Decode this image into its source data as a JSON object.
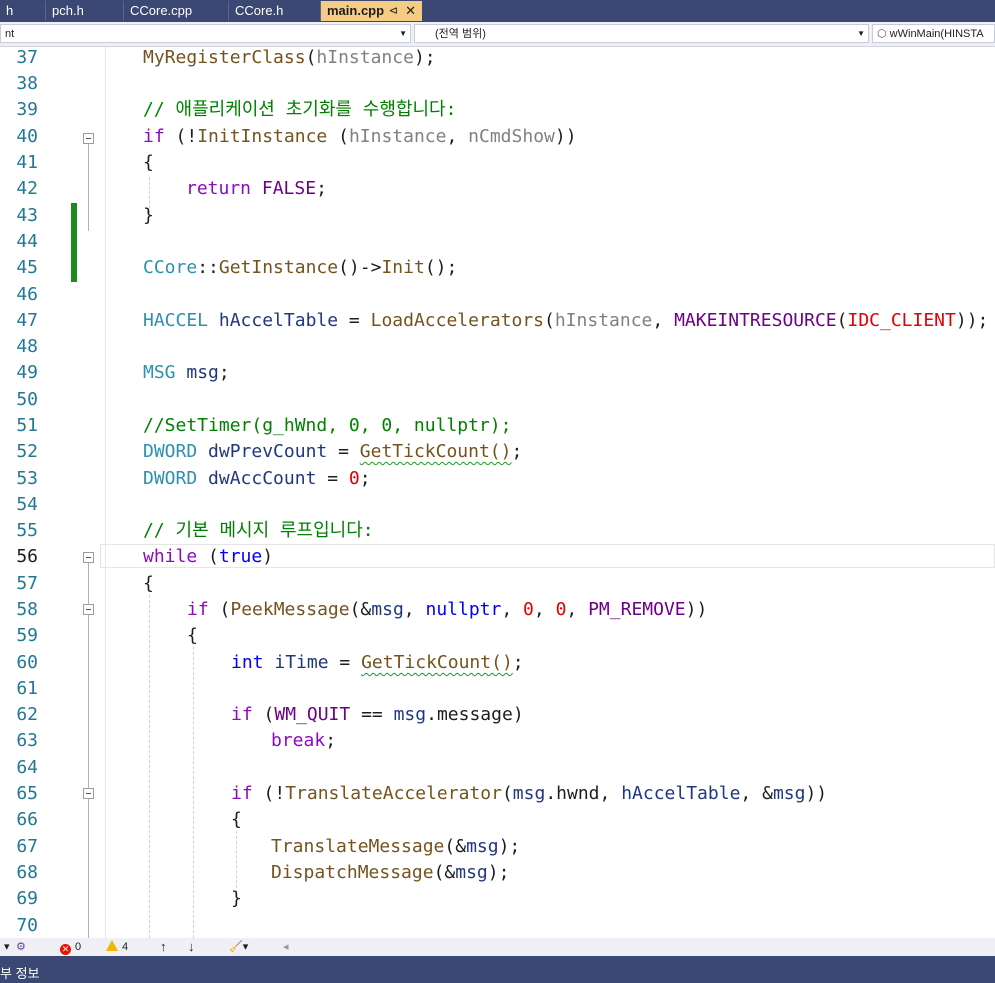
{
  "tabs": [
    {
      "label": "h"
    },
    {
      "label": "pch.h"
    },
    {
      "label": "CCore.cpp"
    },
    {
      "label": "CCore.h"
    },
    {
      "label": "main.cpp",
      "active": true
    }
  ],
  "tab_pin_glyph": "⊲",
  "tab_close_glyph": "✕",
  "navbar": {
    "project_combo": "nt",
    "scope_combo": "(전역 범위)",
    "member_combo": "wWinMain(HINSTA"
  },
  "line_numbers": [
    "37",
    "38",
    "39",
    "40",
    "41",
    "42",
    "43",
    "44",
    "45",
    "46",
    "47",
    "48",
    "49",
    "50",
    "51",
    "52",
    "53",
    "54",
    "55",
    "56",
    "57",
    "58",
    "59",
    "60",
    "61",
    "62",
    "63",
    "64",
    "65",
    "66",
    "67",
    "68",
    "69",
    "70"
  ],
  "current_line": "56",
  "code": {
    "l37": {
      "fn": "MyRegisterClass",
      "p1": "(",
      "pa": "hInstance",
      "p2": ");"
    },
    "l39": {
      "cm": "// 애플리케이션 초기화를 수행합니다:"
    },
    "l40": {
      "kw": "if",
      "t1": " (!",
      "fn": "InitInstance",
      "t2": " (",
      "pa1": "hInstance",
      "t3": ", ",
      "pa2": "nCmdShow",
      "t4": "))"
    },
    "l41": {
      "t": "{"
    },
    "l42": {
      "kw": "return",
      "sp": " ",
      "mc": "FALSE",
      "t": ";"
    },
    "l43": {
      "t": "}"
    },
    "l45": {
      "ty": "CCore",
      "t1": "::",
      "fn1": "GetInstance",
      "t2": "()->",
      "fn2": "Init",
      "t3": "();"
    },
    "l47": {
      "ty": "HACCEL",
      "t1": " ",
      "va": "hAccelTable",
      "t2": " = ",
      "fn": "LoadAccelerators",
      "t3": "(",
      "pa": "hInstance",
      "t4": ", ",
      "mc": "MAKEINTRESOURCE",
      "t5": "(",
      "nu": "IDC_CLIENT",
      "t6": "));"
    },
    "l49": {
      "ty": "MSG",
      "t1": " ",
      "va": "msg",
      "t2": ";"
    },
    "l51": {
      "cm": "//SetTimer(g_hWnd, 0, 0, nullptr);"
    },
    "l52": {
      "ty": "DWORD",
      "t1": " ",
      "va": "dwPrevCount",
      "t2": " = ",
      "fn": "GetTickCount()",
      "t3": ";"
    },
    "l53": {
      "ty": "DWORD",
      "t1": " ",
      "va": "dwAccCount",
      "t2": " = ",
      "nu": "0",
      "t3": ";"
    },
    "l55": {
      "cm": "// 기본 메시지 루프입니다:"
    },
    "l56": {
      "kw": "while",
      "t1": " (",
      "kb": "true",
      "t2": ")"
    },
    "l57": {
      "t": "{"
    },
    "l58": {
      "kw": "if",
      "t1": " (",
      "fn": "PeekMessage",
      "t2": "(&",
      "va": "msg",
      "t3": ", ",
      "kb": "nullptr",
      "t4": ", ",
      "nu1": "0",
      "t5": ", ",
      "nu2": "0",
      "t6": ", ",
      "mc": "PM_REMOVE",
      "t7": "))"
    },
    "l59": {
      "t": "{"
    },
    "l60": {
      "kb": "int",
      "t1": " ",
      "va": "iTime",
      "t2": " = ",
      "fn": "GetTickCount()",
      "t3": ";"
    },
    "l62": {
      "kw": "if",
      "t1": " (",
      "mc": "WM_QUIT",
      "t2": " == ",
      "va": "msg",
      "t3": ".",
      "mem": "message",
      "t4": ")"
    },
    "l63": {
      "kw": "break",
      "t": ";"
    },
    "l65": {
      "kw": "if",
      "t1": " (!",
      "fn": "TranslateAccelerator",
      "t2": "(",
      "va1": "msg",
      "t3": ".",
      "mem": "hwnd",
      "t4": ", ",
      "va2": "hAccelTable",
      "t5": ", &",
      "va3": "msg",
      "t6": "))"
    },
    "l66": {
      "t": "{"
    },
    "l67": {
      "fn": "TranslateMessage",
      "t1": "(&",
      "va": "msg",
      "t2": ");"
    },
    "l68": {
      "fn": "DispatchMessage",
      "t1": "(&",
      "va": "msg",
      "t2": ");"
    },
    "l69": {
      "t": "}"
    }
  },
  "statusbar": {
    "errors": "0",
    "warnings": "4"
  },
  "footer": {
    "label": "부 정보"
  },
  "colors": {
    "tabbar": "#3b4873",
    "active_tab": "#f5cc84",
    "change_marker": "#1c8a1c",
    "line_number": "#237893"
  }
}
